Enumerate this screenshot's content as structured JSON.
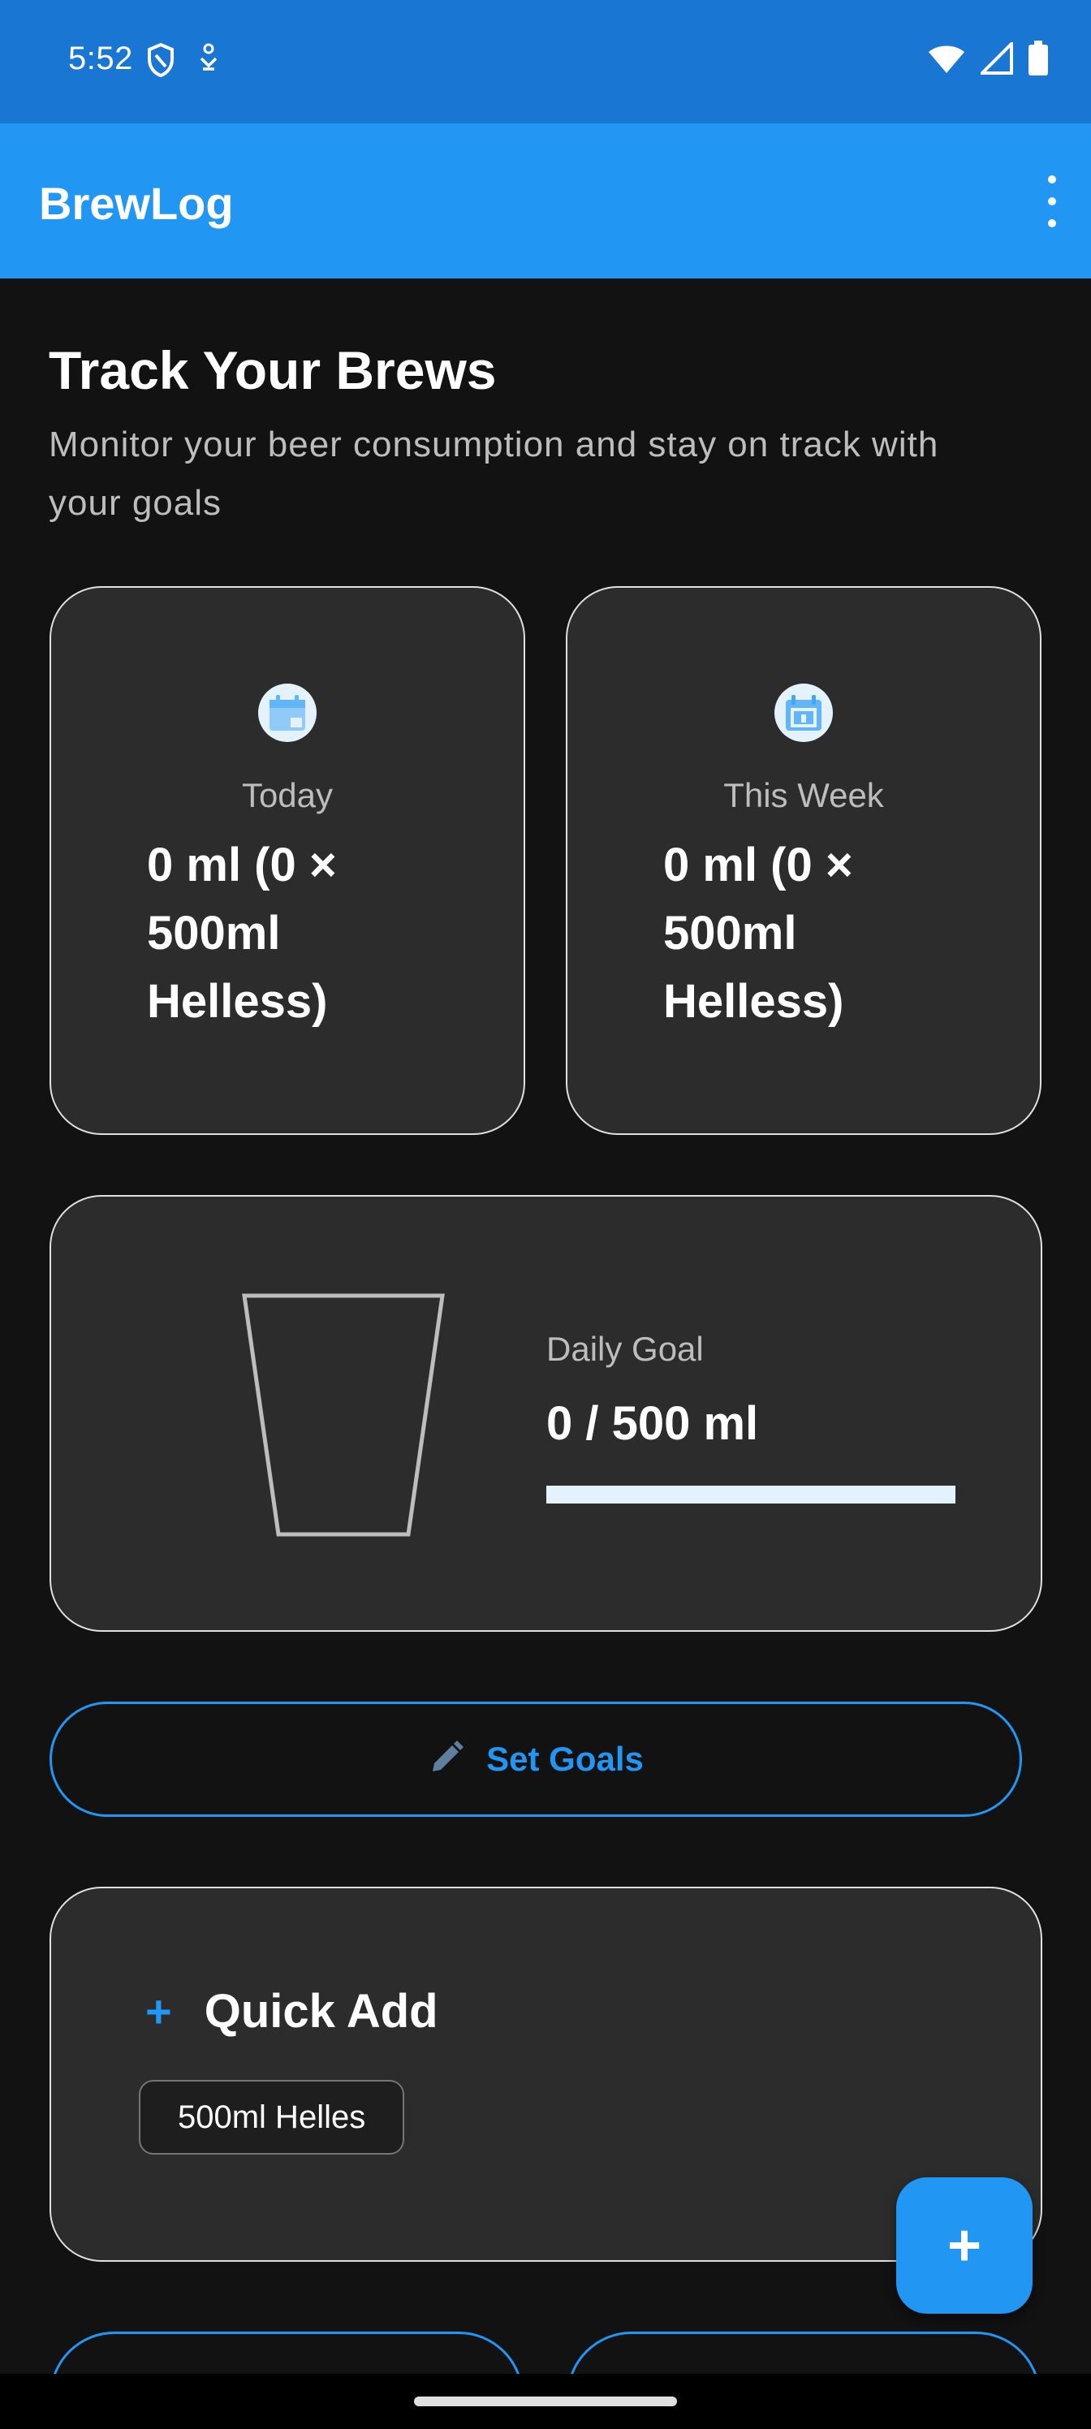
{
  "status_bar": {
    "time": "5:52"
  },
  "app_bar": {
    "title": "BrewLog"
  },
  "header": {
    "title": "Track Your Brews",
    "subtitle": "Monitor your beer consumption and stay on track with your goals"
  },
  "stats": {
    "today": {
      "label": "Today",
      "value": "0 ml (0 × 500ml Helless)"
    },
    "week": {
      "label": "This Week",
      "value": "0 ml (0 × 500ml Helless)"
    }
  },
  "daily_goal": {
    "label": "Daily Goal",
    "value": "0 / 500 ml",
    "progress": 0
  },
  "set_goals": {
    "label": "Set Goals"
  },
  "quick_add": {
    "title": "Quick Add",
    "items": [
      "500ml Helles"
    ]
  },
  "colors": {
    "primary": "#2196F3",
    "status_bar": "#1976D2",
    "background": "#121212",
    "card": "#2c2c2c"
  }
}
